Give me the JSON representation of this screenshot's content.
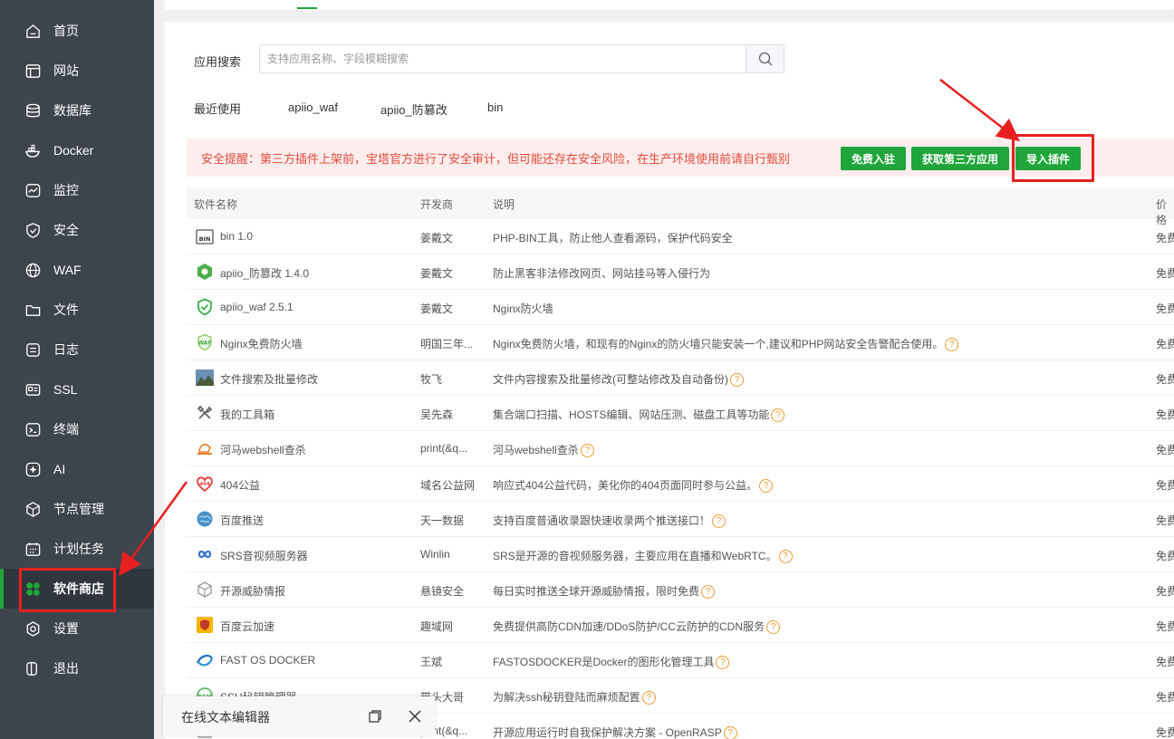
{
  "sidebar": {
    "items": [
      {
        "label": "首页",
        "icon": "home-icon"
      },
      {
        "label": "网站",
        "icon": "website-icon"
      },
      {
        "label": "数据库",
        "icon": "database-icon"
      },
      {
        "label": "Docker",
        "icon": "docker-icon"
      },
      {
        "label": "监控",
        "icon": "monitor-icon"
      },
      {
        "label": "安全",
        "icon": "shield-icon"
      },
      {
        "label": "WAF",
        "icon": "waf-icon"
      },
      {
        "label": "文件",
        "icon": "folder-icon"
      },
      {
        "label": "日志",
        "icon": "log-icon"
      },
      {
        "label": "SSL",
        "icon": "ssl-icon"
      },
      {
        "label": "终端",
        "icon": "terminal-icon"
      },
      {
        "label": "AI",
        "icon": "ai-icon"
      },
      {
        "label": "节点管理",
        "icon": "node-icon"
      },
      {
        "label": "计划任务",
        "icon": "calendar-icon"
      },
      {
        "label": "软件商店",
        "icon": "store-icon"
      },
      {
        "label": "设置",
        "icon": "settings-icon"
      },
      {
        "label": "退出",
        "icon": "logout-icon"
      }
    ],
    "active_index": 14,
    "accent": "#20a53a"
  },
  "search": {
    "label": "应用搜索",
    "placeholder": "支持应用名称、字段模糊搜索"
  },
  "recent": {
    "label": "最近使用",
    "items": [
      "apiio_waf",
      "apiio_防篡改",
      "bin"
    ]
  },
  "alert": {
    "text": "安全提醒：第三方插件上架前，宝塔官方进行了安全审计，但可能还存在安全风险，在生产环境使用前请自行甄别",
    "buttons": [
      "免费入驻",
      "获取第三方应用",
      "导入插件"
    ]
  },
  "table": {
    "columns": [
      "软件名称",
      "开发商",
      "说明",
      "价格"
    ],
    "rows": [
      {
        "name": "bin 1.0",
        "dev": "姜戴文",
        "desc": "PHP-BIN工具，防止他人查看源码，保护代码安全",
        "help": false,
        "price": "免费",
        "icon": "bin-icon"
      },
      {
        "name": "apiio_防篡改 1.4.0",
        "dev": "姜戴文",
        "desc": "防止黑客非法修改网页、网站挂马等入侵行为",
        "help": false,
        "price": "免费",
        "icon": "tamper-proof-icon"
      },
      {
        "name": "apiio_waf 2.5.1",
        "dev": "姜戴文",
        "desc": "Nginx防火墙",
        "help": false,
        "price": "免费",
        "icon": "shield-check-icon"
      },
      {
        "name": "Nginx免费防火墙",
        "dev": "明国三年...",
        "desc": "Nginx免费防火墙，和现有的Nginx的防火墙只能安装一个,建议和PHP网站安全告警配合使用。",
        "help": true,
        "price": "免费",
        "icon": "waf-badge-icon"
      },
      {
        "name": "文件搜索及批量修改",
        "dev": "牧飞",
        "desc": "文件内容搜索及批量修改(可整站修改及自动备份)",
        "help": true,
        "price": "免费",
        "icon": "landscape-icon"
      },
      {
        "name": "我的工具箱",
        "dev": "吴先森",
        "desc": "集合端口扫描、HOSTS编辑、网站压测、磁盘工具等功能",
        "help": true,
        "price": "免费",
        "icon": "tools-icon"
      },
      {
        "name": "河马webshell查杀",
        "dev": "print(&q...",
        "desc": "河马webshell查杀",
        "help": true,
        "price": "免费",
        "icon": "hippo-icon"
      },
      {
        "name": "404公益",
        "dev": "域名公益网",
        "desc": "响应式404公益代码，美化你的404页面同时参与公益。",
        "help": true,
        "price": "免费",
        "icon": "heart-icon"
      },
      {
        "name": "百度推送",
        "dev": "天一数据",
        "desc": "支持百度普通收录跟快速收录两个推送接口！",
        "help": true,
        "price": "免费",
        "icon": "globe-icon"
      },
      {
        "name": "SRS音视频服务器",
        "dev": "Winlin",
        "desc": "SRS是开源的音视频服务器，主要应用在直播和WebRTC。",
        "help": true,
        "price": "免费",
        "icon": "infinity-icon"
      },
      {
        "name": "开源威胁情报",
        "dev": "悬镜安全",
        "desc": "每日实时推送全球开源威胁情报，限时免费",
        "help": true,
        "price": "免费",
        "icon": "cube-icon"
      },
      {
        "name": "百度云加速",
        "dev": "趣域网",
        "desc": "免费提供高防CDN加速/DDoS防护/CC云防护的CDN服务",
        "help": true,
        "price": "免费",
        "icon": "cloud-shield-icon"
      },
      {
        "name": "FAST OS DOCKER",
        "dev": "王斌",
        "desc": "FASTOSDOCKER是Docker的图形化管理工具",
        "help": true,
        "price": "免费",
        "icon": "fastos-icon"
      },
      {
        "name": "SSH秘钥管理器",
        "dev": "带头大哥",
        "desc": "为解决ssh秘钥登陆而麻烦配置",
        "help": true,
        "price": "免费",
        "icon": "key-icon"
      },
      {
        "name": "",
        "dev": "print(&q...",
        "desc": "开源应用运行时自我保护解决方案 - OpenRASP",
        "help": true,
        "price": "免费",
        "icon": "rasp-icon"
      }
    ]
  },
  "editor_bar": {
    "title": "在线文本编辑器"
  },
  "colors": {
    "green": "#20a53a",
    "alert_bg": "#fdeded",
    "alert_text": "#e24b3b",
    "annotation_red": "#e8201f"
  }
}
